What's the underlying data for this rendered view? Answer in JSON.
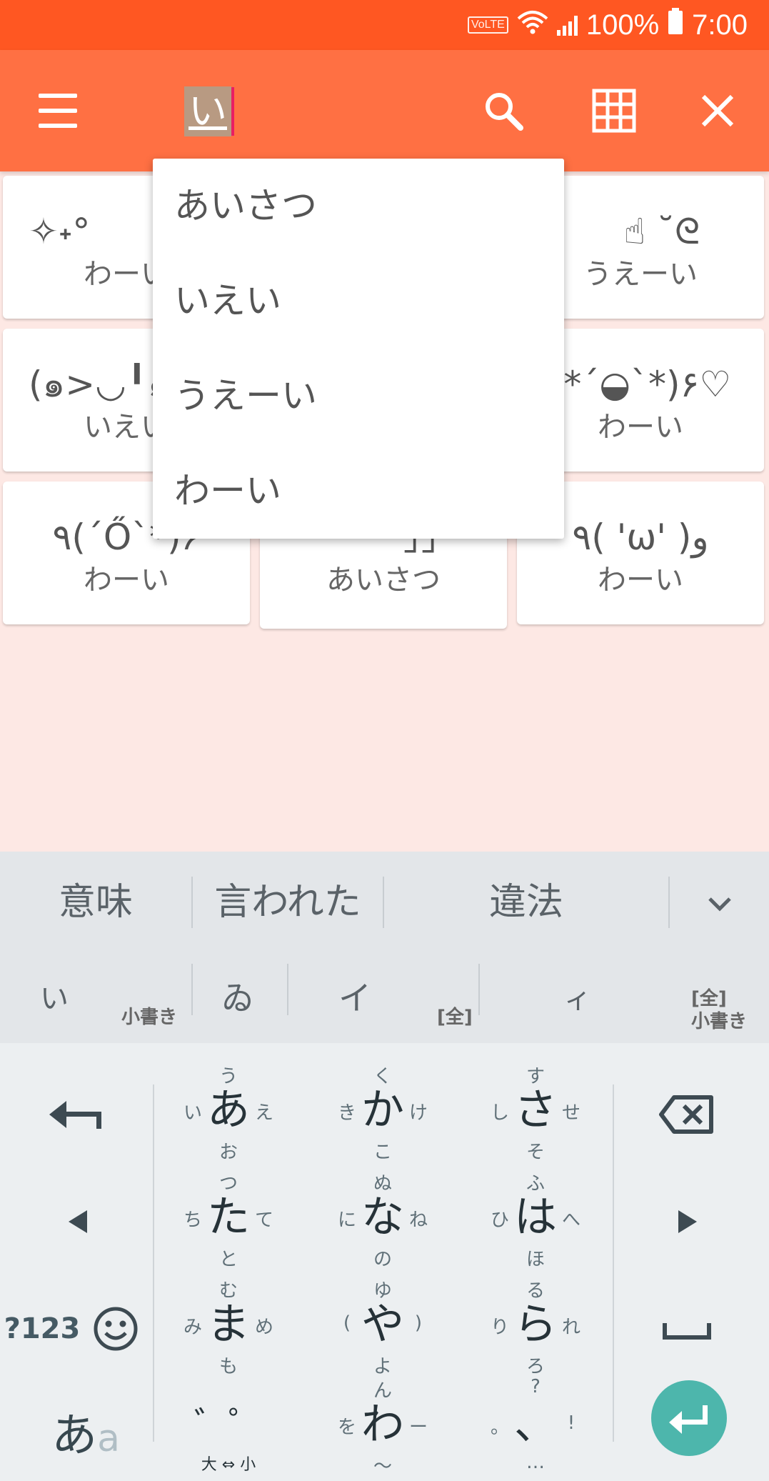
{
  "status_bar": {
    "volte": "VoLTE",
    "battery": "100%",
    "time": "7:00"
  },
  "toolbar": {
    "search_text": "い"
  },
  "cards": [
    {
      "emoticon": "✧˖°",
      "label": "わーい"
    },
    {
      "emoticon": "",
      "label": ""
    },
    {
      "emoticon": "☝ ˘ᘓ",
      "label": "うえーい"
    },
    {
      "emoticon": "(๑>◡╹๑",
      "label": "いえい"
    },
    {
      "emoticon": "",
      "label": ""
    },
    {
      "emoticon": "(*´◒`*)۶♡",
      "label": "わーい"
    },
    {
      "emoticon": "٩(´Ő`*)۶",
      "label": "わーい"
    },
    {
      "emoticon": "」」",
      "label": "あいさつ"
    },
    {
      "emoticon": "٩( 'ω' )و",
      "label": "わーい"
    }
  ],
  "dropdown": [
    "あいさつ",
    "いえい",
    "うえーい",
    "わーい"
  ],
  "keyboard": {
    "suggestions": [
      "意味",
      "言われた",
      "違法"
    ],
    "variants": {
      "small_i": "い",
      "small_i_note": "小書き",
      "wi": "ゐ",
      "katakana_i": "イ",
      "full_note": "[全]",
      "small_katakana_i": "ィ",
      "full_small_note_1": "[全]",
      "full_small_note_2": "小書き"
    },
    "num_key": "?123",
    "mode_main": "あ",
    "mode_sub": "a",
    "dakuten_sub": "大 ⇔ 小",
    "kana": [
      {
        "c": "あ",
        "t": "う",
        "b": "お",
        "l": "い",
        "r": "え"
      },
      {
        "c": "か",
        "t": "く",
        "b": "こ",
        "l": "き",
        "r": "け"
      },
      {
        "c": "さ",
        "t": "す",
        "b": "そ",
        "l": "し",
        "r": "せ"
      },
      {
        "c": "た",
        "t": "つ",
        "b": "と",
        "l": "ち",
        "r": "て"
      },
      {
        "c": "な",
        "t": "ぬ",
        "b": "の",
        "l": "に",
        "r": "ね"
      },
      {
        "c": "は",
        "t": "ふ",
        "b": "ほ",
        "l": "ひ",
        "r": "へ"
      },
      {
        "c": "ま",
        "t": "む",
        "b": "も",
        "l": "み",
        "r": "め"
      },
      {
        "c": "や",
        "t": "ゆ",
        "b": "よ",
        "l": "(",
        "r": ")"
      },
      {
        "c": "ら",
        "t": "る",
        "b": "ろ",
        "l": "り",
        "r": "れ"
      },
      {
        "c": "゛゜",
        "t": "",
        "b": "",
        "l": "",
        "r": ""
      },
      {
        "c": "わ",
        "t": "ん",
        "b": "～",
        "l": "を",
        "r": "ー"
      },
      {
        "c": "、",
        "t": "?",
        "b": "…",
        "l": "。",
        "r": "!"
      }
    ]
  }
}
